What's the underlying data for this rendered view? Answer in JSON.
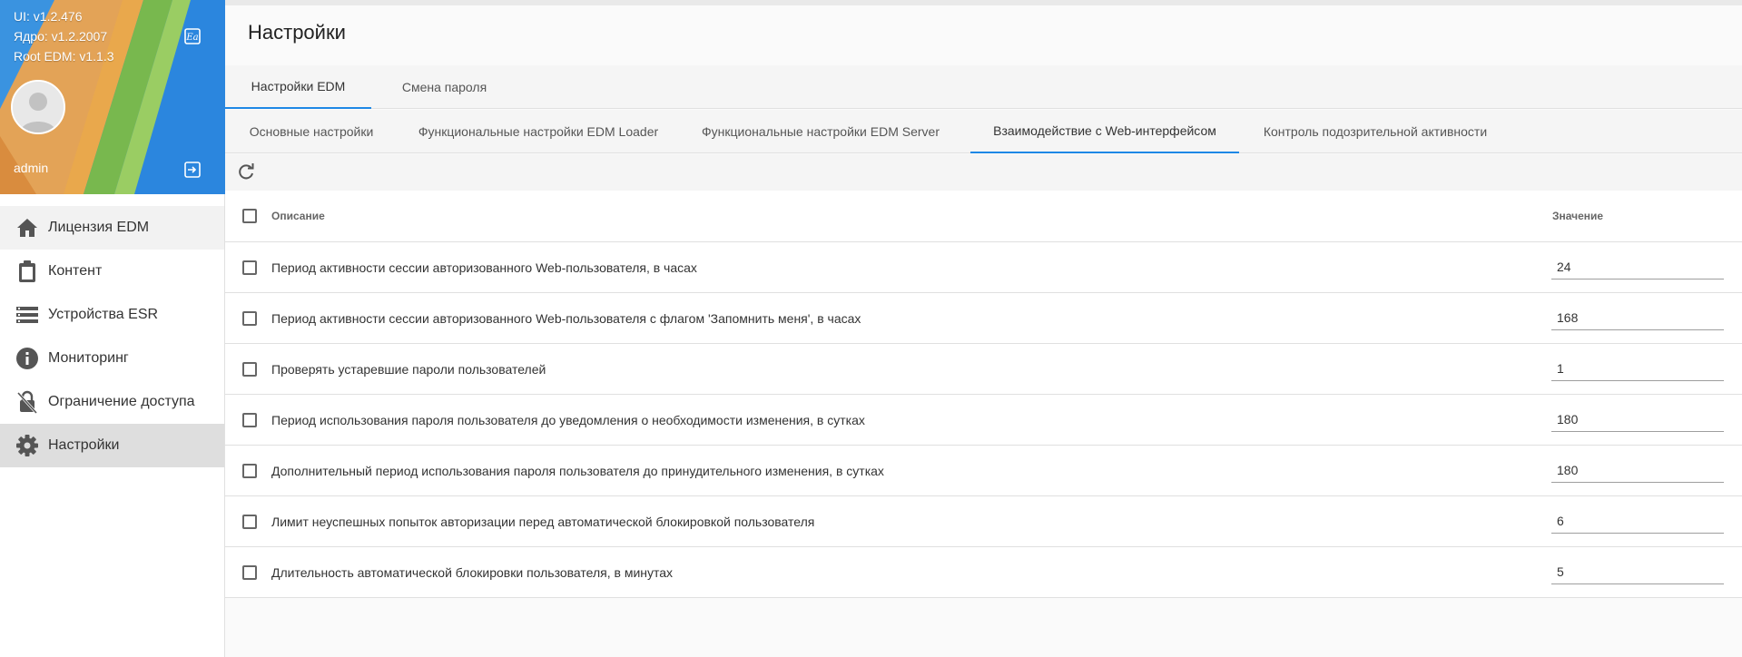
{
  "sidebar": {
    "versions": {
      "ui": "UI: v1.2.476",
      "core": "Ядро: v1.2.2007",
      "root": "Root EDM: v1.1.3"
    },
    "username": "admin",
    "items": [
      {
        "label": "Лицензия EDM",
        "icon": "home-icon"
      },
      {
        "label": "Контент",
        "icon": "clipboard-icon"
      },
      {
        "label": "Устройства ESR",
        "icon": "storage-icon"
      },
      {
        "label": "Мониторинг",
        "icon": "info-icon"
      },
      {
        "label": "Ограничение доступа",
        "icon": "lock-off-icon"
      },
      {
        "label": "Настройки",
        "icon": "gear-icon"
      }
    ]
  },
  "page": {
    "title": "Настройки"
  },
  "tabs1": [
    {
      "label": "Настройки EDM",
      "active": true
    },
    {
      "label": "Смена пароля",
      "active": false
    }
  ],
  "tabs2": [
    {
      "label": "Основные настройки",
      "active": false
    },
    {
      "label": "Функциональные настройки EDM Loader",
      "active": false
    },
    {
      "label": "Функциональные настройки EDM Server",
      "active": false
    },
    {
      "label": "Взаимодействие с Web-интерфейсом",
      "active": true
    },
    {
      "label": "Контроль подозрительной активности",
      "active": false
    }
  ],
  "table": {
    "headers": {
      "description": "Описание",
      "value": "Значение"
    },
    "rows": [
      {
        "description": "Период активности сессии авторизованного Web-пользователя, в часах",
        "value": "24"
      },
      {
        "description": "Период активности сессии авторизованного Web-пользователя с флагом 'Запомнить меня', в часах",
        "value": "168"
      },
      {
        "description": "Проверять устаревшие пароли пользователей",
        "value": "1"
      },
      {
        "description": "Период использования пароля пользователя до уведомления о необходимости изменения, в сутках",
        "value": "180"
      },
      {
        "description": "Дополнительный период использования пароля пользователя до принудительного изменения, в сутках",
        "value": "180"
      },
      {
        "description": "Лимит неуспешных попыток авторизации перед автоматической блокировкой пользователя",
        "value": "6"
      },
      {
        "description": "Длительность автоматической блокировки пользователя, в минутах",
        "value": "5"
      }
    ]
  },
  "colors": {
    "accent": "#1e88e5",
    "active_nav": "#dedede"
  }
}
